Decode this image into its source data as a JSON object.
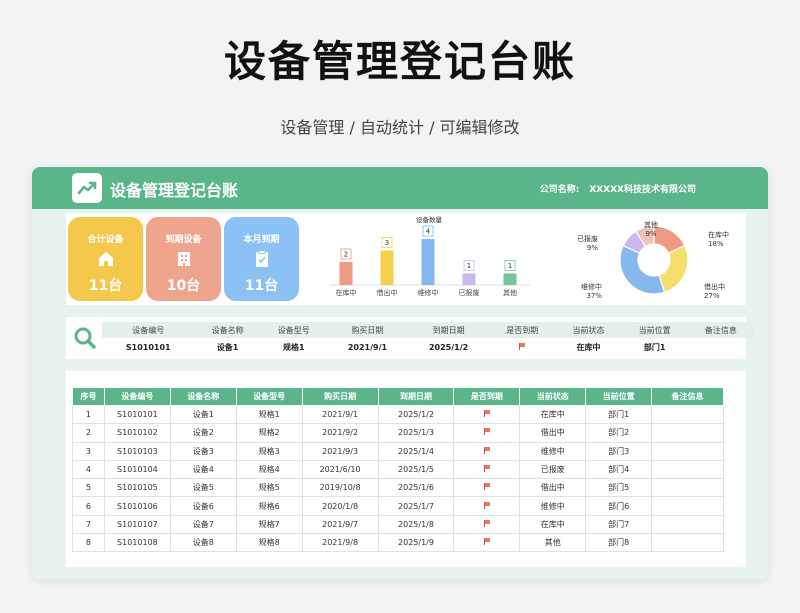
{
  "page": {
    "title": "设备管理登记台账",
    "subtitle": "设备管理 / 自动统计 / 可编辑修改"
  },
  "header": {
    "title": "设备管理登记台账",
    "company_label": "公司名称:",
    "company_name": "XXXXX科技技术有限公司",
    "colors": {
      "accent": "#5bb58a"
    }
  },
  "stats": [
    {
      "label": "合计设备",
      "value": "11台",
      "icon": "home-icon",
      "color": "#f3c84b"
    },
    {
      "label": "到期设备",
      "value": "10台",
      "icon": "building-icon",
      "color": "#eea48d"
    },
    {
      "label": "本月到期",
      "value": "11台",
      "icon": "clipboard-icon",
      "color": "#8cc1f5"
    }
  ],
  "chart_data": [
    {
      "type": "bar",
      "title": "设备数量",
      "categories": [
        "在库中",
        "借出中",
        "维修中",
        "已报废",
        "其他"
      ],
      "values": [
        2,
        3,
        4,
        1,
        1
      ],
      "colors": [
        "#ee9a85",
        "#f5cf4e",
        "#86b8ee",
        "#cdb7ef",
        "#76c39e"
      ],
      "ylim": [
        0,
        4
      ]
    },
    {
      "type": "pie",
      "labels": [
        "在库中",
        "借出中",
        "维修中",
        "已报废",
        "其他"
      ],
      "values": [
        18,
        27,
        37,
        9,
        9
      ],
      "value_labels": [
        "18%",
        "27%",
        "37%",
        "9%",
        "9%"
      ],
      "colors": [
        "#ee9a85",
        "#f5df6a",
        "#86b8ee",
        "#cdb7ef",
        "#f2c3b4"
      ]
    }
  ],
  "search": {
    "headers": [
      "设备编号",
      "设备名称",
      "设备型号",
      "购买日期",
      "到期日期",
      "是否到期",
      "当前状态",
      "当前位置",
      "备注信息"
    ],
    "row": [
      "S1010101",
      "设备1",
      "规格1",
      "2021/9/1",
      "2025/1/2",
      "",
      "在库中",
      "部门1",
      ""
    ]
  },
  "table": {
    "headers": [
      "序号",
      "设备编号",
      "设备名称",
      "设备型号",
      "购买日期",
      "到期日期",
      "是否到期",
      "当前状态",
      "当前位置",
      "备注信息"
    ],
    "rows": [
      [
        "1",
        "S1010101",
        "设备1",
        "规格1",
        "2021/9/1",
        "2025/1/2",
        "",
        "在库中",
        "部门1",
        ""
      ],
      [
        "2",
        "S1010102",
        "设备2",
        "规格2",
        "2021/9/2",
        "2025/1/3",
        "",
        "借出中",
        "部门2",
        ""
      ],
      [
        "3",
        "S1010103",
        "设备3",
        "规格3",
        "2021/9/3",
        "2025/1/4",
        "",
        "维修中",
        "部门3",
        ""
      ],
      [
        "4",
        "S1010104",
        "设备4",
        "规格4",
        "2021/6/10",
        "2025/1/5",
        "",
        "已报废",
        "部门4",
        ""
      ],
      [
        "5",
        "S1010105",
        "设备5",
        "规格5",
        "2019/10/8",
        "2025/1/6",
        "",
        "借出中",
        "部门5",
        ""
      ],
      [
        "6",
        "S1010106",
        "设备6",
        "规格6",
        "2020/1/8",
        "2025/1/7",
        "",
        "维修中",
        "部门6",
        ""
      ],
      [
        "7",
        "S1010107",
        "设备7",
        "规格7",
        "2021/9/7",
        "2025/1/8",
        "",
        "在库中",
        "部门7",
        ""
      ],
      [
        "8",
        "S1010108",
        "设备8",
        "规格8",
        "2021/9/8",
        "2025/1/9",
        "",
        "其他",
        "部门8",
        ""
      ]
    ]
  }
}
